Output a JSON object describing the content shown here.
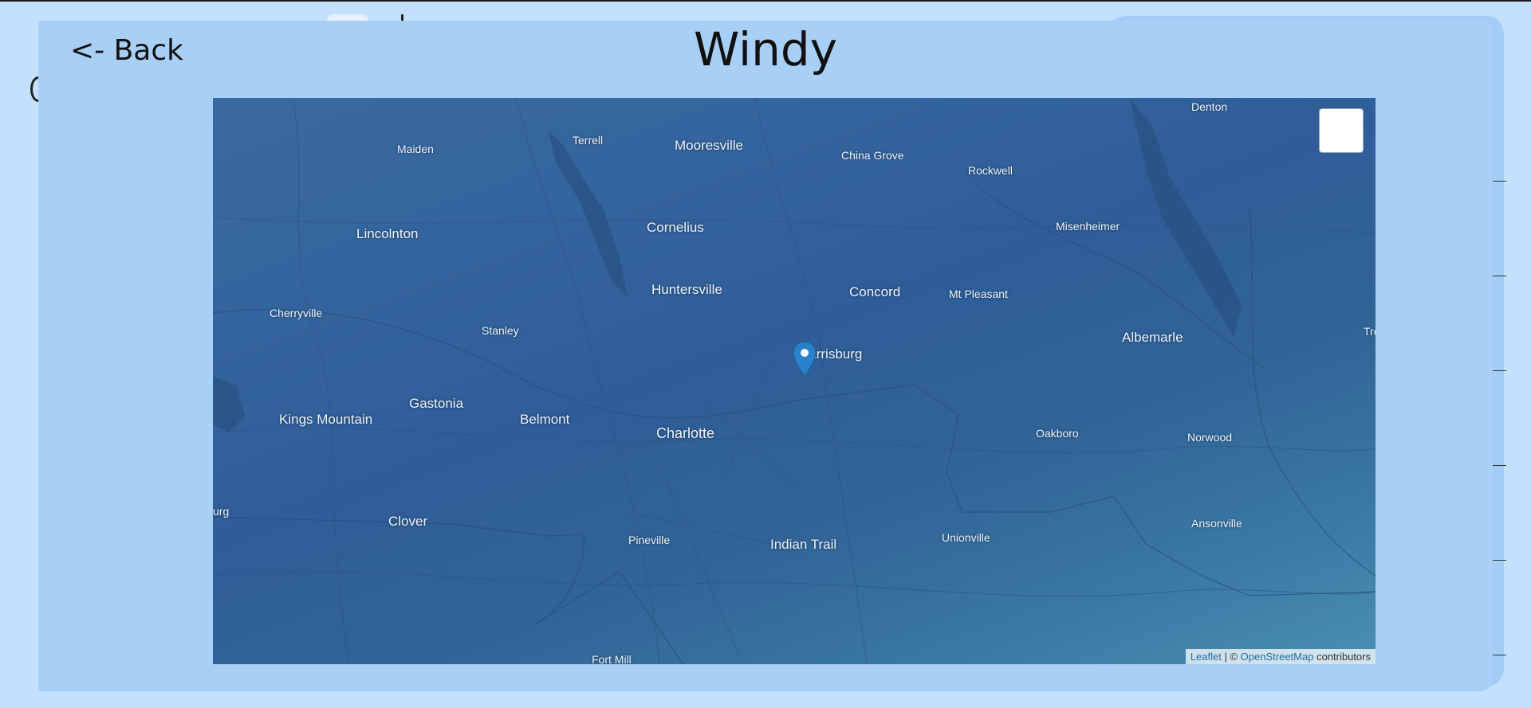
{
  "header": {
    "back_label": "<- Back",
    "title": "Windy"
  },
  "map": {
    "places": [
      {
        "name": "Denton",
        "size": "md"
      },
      {
        "name": "Terrell",
        "size": "md"
      },
      {
        "name": "Mooresville",
        "size": "lg"
      },
      {
        "name": "Maiden",
        "size": "md"
      },
      {
        "name": "China Grove",
        "size": "md"
      },
      {
        "name": "Rockwell",
        "size": "md"
      },
      {
        "name": "Lincolnton",
        "size": "lg"
      },
      {
        "name": "Cornelius",
        "size": "lg"
      },
      {
        "name": "Misenheimer",
        "size": "md"
      },
      {
        "name": "Huntersville",
        "size": "lg"
      },
      {
        "name": "Concord",
        "size": "lg"
      },
      {
        "name": "Mt Pleasant",
        "size": "md"
      },
      {
        "name": "Cherryville",
        "size": "md"
      },
      {
        "name": "Stanley",
        "size": "md"
      },
      {
        "name": "Albemarle",
        "size": "lg"
      },
      {
        "name": "Tro",
        "size": "md"
      },
      {
        "name": "Harrisburg",
        "size": "lg"
      },
      {
        "name": "Gastonia",
        "size": "lg"
      },
      {
        "name": "Kings Mountain",
        "size": "lg"
      },
      {
        "name": "Belmont",
        "size": "lg"
      },
      {
        "name": "Charlotte",
        "size": "xl"
      },
      {
        "name": "Oakboro",
        "size": "md"
      },
      {
        "name": "Norwood",
        "size": "md"
      },
      {
        "name": "urg",
        "size": "md"
      },
      {
        "name": "Clover",
        "size": "lg"
      },
      {
        "name": "Ansonville",
        "size": "md"
      },
      {
        "name": "Pineville",
        "size": "md"
      },
      {
        "name": "Indian Trail",
        "size": "lg"
      },
      {
        "name": "Unionville",
        "size": "md"
      },
      {
        "name": "Fort Mill",
        "size": "md"
      }
    ],
    "attribution": {
      "leaflet": "Leaflet",
      "separator": " | © ",
      "osm": "OpenStreetMap",
      "suffix": " contributors"
    },
    "marker_color": "#2a81cb"
  },
  "colors": {
    "page_bg": "#c3e0fd",
    "modal_bg": "#a8cff6",
    "map_water": "#2f5d98"
  }
}
